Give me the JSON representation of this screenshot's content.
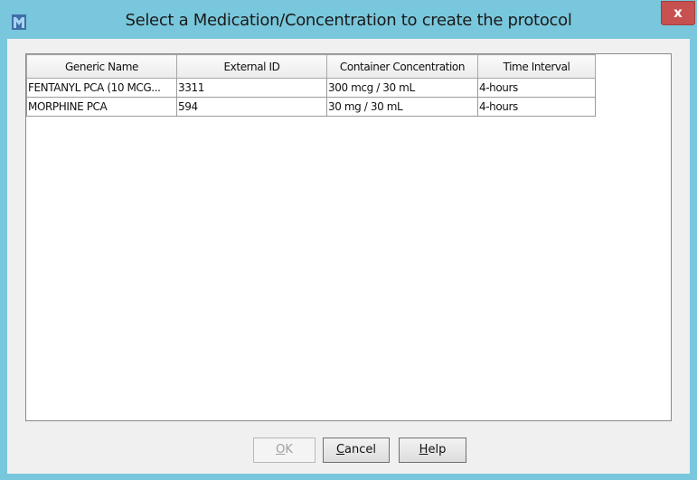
{
  "window": {
    "title": "Select a Medication/Concentration to create the protocol",
    "close_label": "x",
    "app_icon": "app-logo-icon"
  },
  "table": {
    "columns": [
      "Generic Name",
      "External ID",
      "Container Concentration",
      "Time Interval"
    ],
    "rows": [
      [
        "FENTANYL PCA (10 MCG...",
        "3311",
        "300 mcg / 30 mL",
        "4-hours"
      ],
      [
        "MORPHINE PCA",
        "594",
        "30 mg / 30 mL",
        "4-hours"
      ]
    ]
  },
  "buttons": {
    "ok": {
      "mnemonic": "O",
      "rest": "K",
      "enabled": false
    },
    "cancel": {
      "mnemonic": "C",
      "rest": "ancel",
      "enabled": true
    },
    "help": {
      "mnemonic": "H",
      "rest": "elp",
      "enabled": true
    }
  },
  "colors": {
    "frame": "#79c7dc",
    "close": "#c75050",
    "panel": "#f0f0f0"
  }
}
